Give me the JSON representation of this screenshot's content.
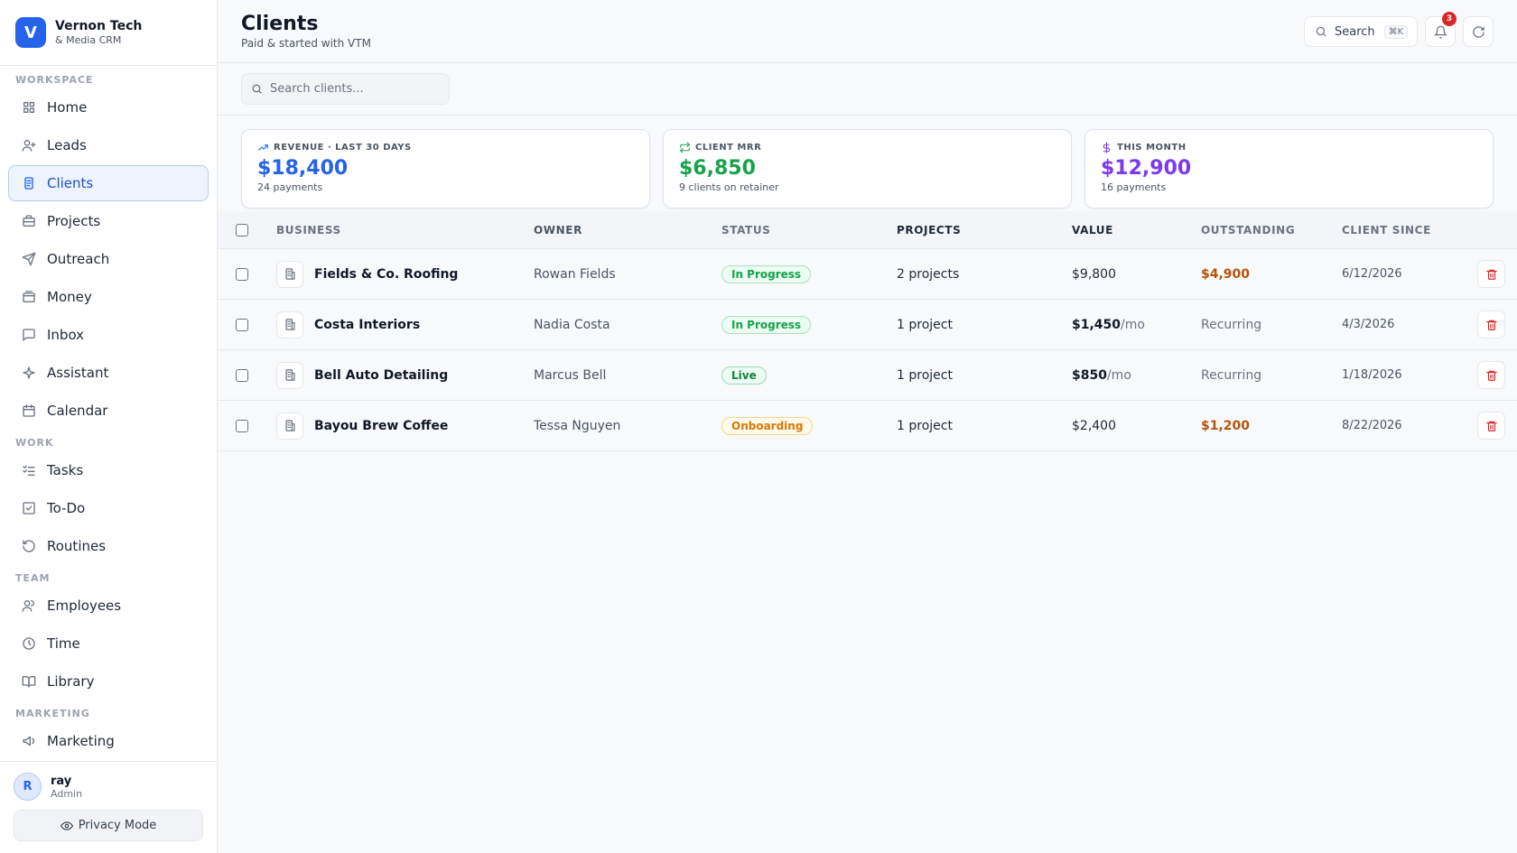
{
  "brand": {
    "logo_letter": "V",
    "name": "Vernon Tech",
    "subtitle": "& Media CRM"
  },
  "sidebar": {
    "sections": [
      {
        "label": "WORKSPACE",
        "items": [
          {
            "label": "Home",
            "icon": "grid-icon",
            "active": false
          },
          {
            "label": "Leads",
            "icon": "user-plus-icon",
            "active": false
          },
          {
            "label": "Clients",
            "icon": "document-icon",
            "active": true
          },
          {
            "label": "Projects",
            "icon": "briefcase-icon",
            "active": false
          },
          {
            "label": "Outreach",
            "icon": "send-icon",
            "active": false
          },
          {
            "label": "Money",
            "icon": "wallet-icon",
            "active": false
          },
          {
            "label": "Inbox",
            "icon": "message-icon",
            "active": false
          },
          {
            "label": "Assistant",
            "icon": "sparkle-icon",
            "active": false
          },
          {
            "label": "Calendar",
            "icon": "calendar-icon",
            "active": false
          }
        ]
      },
      {
        "label": "WORK",
        "items": [
          {
            "label": "Tasks",
            "icon": "list-check-icon",
            "active": false
          },
          {
            "label": "To-Do",
            "icon": "checkbox-icon",
            "active": false
          },
          {
            "label": "Routines",
            "icon": "rotate-icon",
            "active": false
          }
        ]
      },
      {
        "label": "TEAM",
        "items": [
          {
            "label": "Employees",
            "icon": "users-icon",
            "active": false
          },
          {
            "label": "Time",
            "icon": "clock-icon",
            "active": false
          },
          {
            "label": "Library",
            "icon": "book-icon",
            "active": false
          }
        ]
      },
      {
        "label": "MARKETING",
        "items": [
          {
            "label": "Marketing",
            "icon": "megaphone-icon",
            "active": false
          }
        ]
      }
    ]
  },
  "user": {
    "initial": "R",
    "name": "ray",
    "role": "Admin"
  },
  "privacy_label": "Privacy Mode",
  "header": {
    "title": "Clients",
    "subtitle": "Paid & started with VTM",
    "search_label": "Search",
    "search_shortcut": "⌘K",
    "notification_count": "3"
  },
  "search": {
    "placeholder": "Search clients..."
  },
  "stats": [
    {
      "label": "REVENUE · LAST 30 DAYS",
      "value": "$18,400",
      "sub": "24 payments",
      "color": "#2563eb",
      "icon": "trending-up-icon"
    },
    {
      "label": "CLIENT MRR",
      "value": "$6,850",
      "sub": "9 clients on retainer",
      "color": "#16a34a",
      "icon": "repeat-icon"
    },
    {
      "label": "THIS MONTH",
      "value": "$12,900",
      "sub": "16 payments",
      "color": "#7c3aed",
      "icon": "dollar-icon"
    }
  ],
  "table": {
    "columns": [
      "BUSINESS",
      "OWNER",
      "STATUS",
      "PROJECTS",
      "VALUE",
      "OUTSTANDING",
      "CLIENT SINCE"
    ],
    "rows": [
      {
        "business": "Fields & Co. Roofing",
        "owner": "Rowan Fields",
        "status": "In Progress",
        "status_kind": "progress",
        "projects": "2 projects",
        "value": "$9,800",
        "value_unit": "",
        "outstanding": "$4,900",
        "outstanding_kind": "due",
        "since": "6/12/2026"
      },
      {
        "business": "Costa Interiors",
        "owner": "Nadia Costa",
        "status": "In Progress",
        "status_kind": "progress",
        "projects": "1 project",
        "value": "$1,450",
        "value_unit": "/mo",
        "outstanding": "Recurring",
        "outstanding_kind": "recurring",
        "since": "4/3/2026"
      },
      {
        "business": "Bell Auto Detailing",
        "owner": "Marcus Bell",
        "status": "Live",
        "status_kind": "live",
        "projects": "1 project",
        "value": "$850",
        "value_unit": "/mo",
        "outstanding": "Recurring",
        "outstanding_kind": "recurring",
        "since": "1/18/2026"
      },
      {
        "business": "Bayou Brew Coffee",
        "owner": "Tessa Nguyen",
        "status": "Onboarding",
        "status_kind": "onboarding",
        "projects": "1 project",
        "value": "$2,400",
        "value_unit": "",
        "outstanding": "$1,200",
        "outstanding_kind": "due",
        "since": "8/22/2026"
      }
    ]
  }
}
